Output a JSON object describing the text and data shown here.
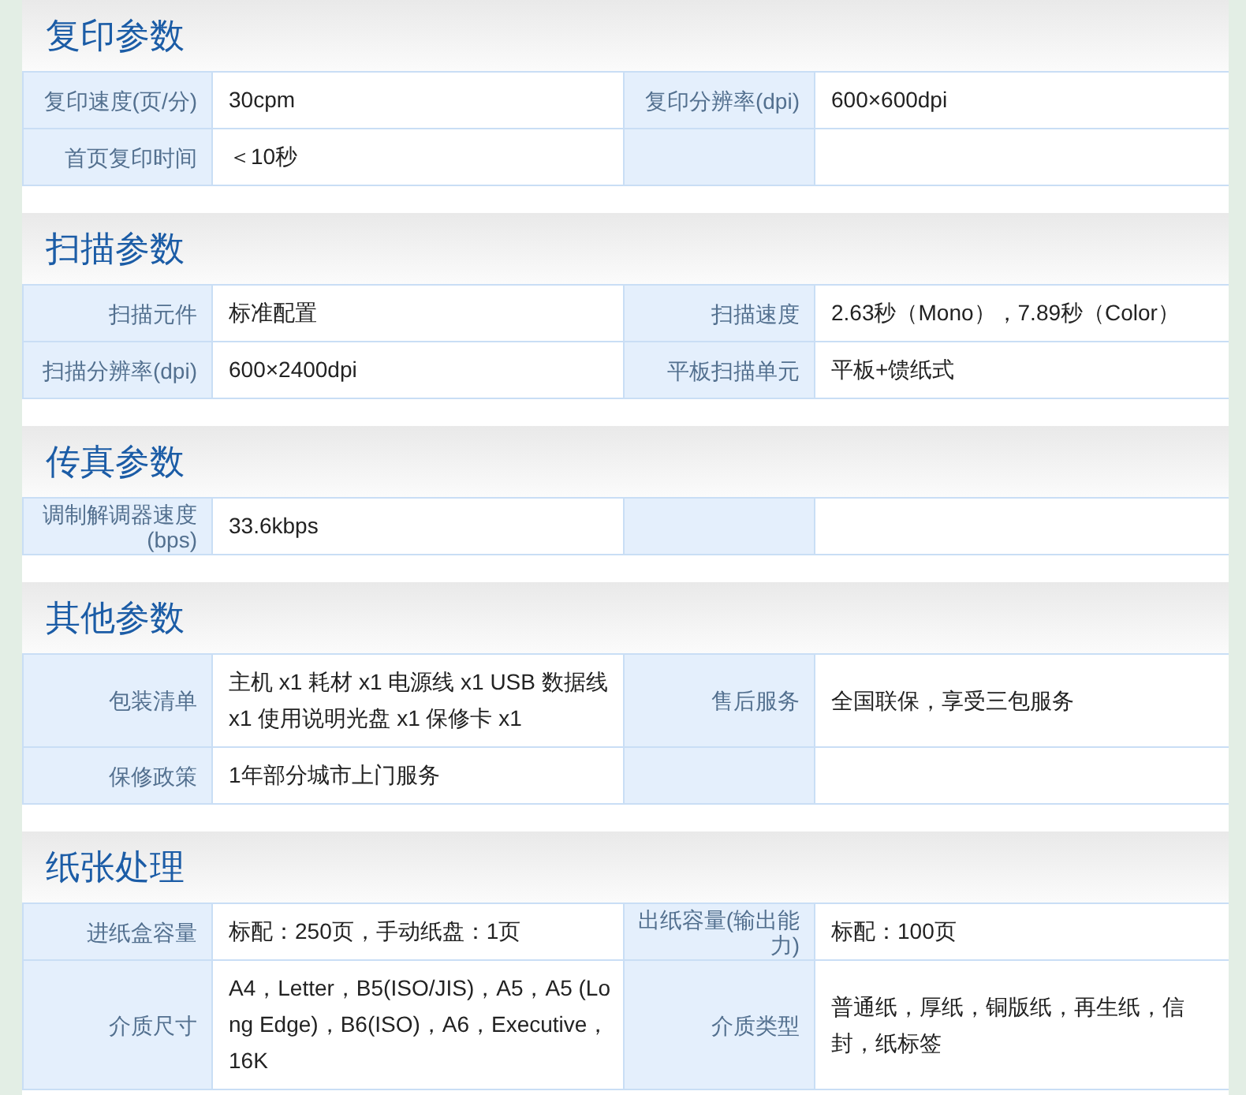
{
  "sections": [
    {
      "title": "复印参数",
      "rows": [
        {
          "pairs": [
            {
              "label": "复印速度(页/分)",
              "value": "30cpm"
            },
            {
              "label": "复印分辨率(dpi)",
              "value": "600×600dpi"
            }
          ]
        },
        {
          "pairs": [
            {
              "label": "首页复印时间",
              "value": "＜10秒"
            }
          ]
        }
      ]
    },
    {
      "title": "扫描参数",
      "rows": [
        {
          "pairs": [
            {
              "label": "扫描元件",
              "value": "标准配置"
            },
            {
              "label": "扫描速度",
              "value": "2.63秒（Mono），7.89秒（Color）"
            }
          ]
        },
        {
          "pairs": [
            {
              "label": "扫描分辨率(dpi)",
              "value": "600×2400dpi"
            },
            {
              "label": "平板扫描单元",
              "value": "平板+馈纸式"
            }
          ]
        }
      ]
    },
    {
      "title": "传真参数",
      "rows": [
        {
          "pairs": [
            {
              "label": "调制解调器速度(bps)",
              "value": "33.6kbps"
            }
          ]
        }
      ]
    },
    {
      "title": "其他参数",
      "rows": [
        {
          "pairs": [
            {
              "label": "包装清单",
              "value": "主机 x1 耗材 x1 电源线 x1 USB 数据线 x1 使用说明光盘 x1 保修卡 x1"
            },
            {
              "label": "售后服务",
              "value": "全国联保，享受三包服务"
            }
          ]
        },
        {
          "pairs": [
            {
              "label": "保修政策",
              "value": "1年部分城市上门服务"
            }
          ]
        }
      ]
    },
    {
      "title": "纸张处理",
      "rows": [
        {
          "pairs": [
            {
              "label": "进纸盒容量",
              "value": "标配：250页，手动纸盘：1页"
            },
            {
              "label": "出纸容量(输出能力)",
              "value": "标配：100页"
            }
          ]
        },
        {
          "pairs": [
            {
              "label": "介质尺寸",
              "value": "A4，Letter，B5(ISO/JIS)，A5，A5 (Long Edge)，B6(ISO)，A6，Executive，16K"
            },
            {
              "label": "介质类型",
              "value": "普通纸，厚纸，铜版纸，再生纸，信封，纸标签"
            }
          ]
        }
      ]
    }
  ]
}
